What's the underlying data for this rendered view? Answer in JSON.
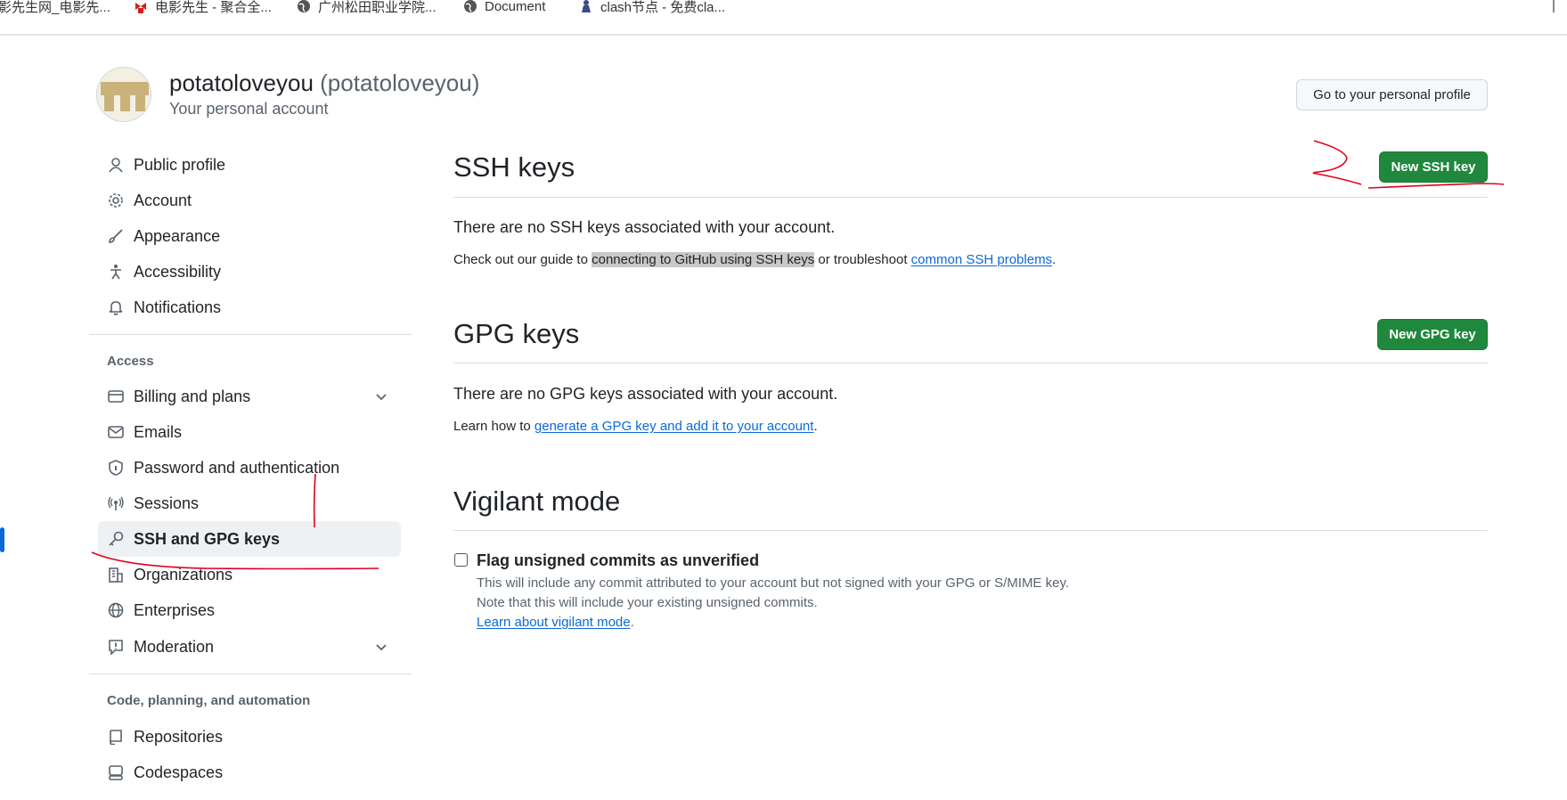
{
  "bookmarks": [
    {
      "label": "影先生网_电影先...",
      "icon": "page-icon"
    },
    {
      "label": "电影先生 - 聚合全...",
      "icon": "bow-icon",
      "color": "#d21f1f"
    },
    {
      "label": "广州松田职业学院...",
      "icon": "globe-icon"
    },
    {
      "label": "Document",
      "icon": "globe-icon"
    },
    {
      "label": "clash节点 - 免费cla...",
      "icon": "person-icon",
      "color": "#3b4a8c"
    }
  ],
  "header": {
    "display_name": "potatoloveyou",
    "login": "(potatoloveyou)",
    "subtitle": "Your personal account",
    "profile_button": "Go to your personal profile"
  },
  "sidebar": {
    "items": [
      {
        "label": "Public profile",
        "icon": "person-icon"
      },
      {
        "label": "Account",
        "icon": "gear-icon"
      },
      {
        "label": "Appearance",
        "icon": "paintbrush-icon"
      },
      {
        "label": "Accessibility",
        "icon": "accessibility-icon"
      },
      {
        "label": "Notifications",
        "icon": "bell-icon"
      }
    ],
    "access_title": "Access",
    "access_items": [
      {
        "label": "Billing and plans",
        "icon": "credit-card-icon",
        "expandable": true
      },
      {
        "label": "Emails",
        "icon": "mail-icon"
      },
      {
        "label": "Password and authentication",
        "icon": "shield-lock-icon"
      },
      {
        "label": "Sessions",
        "icon": "broadcast-icon"
      },
      {
        "label": "SSH and GPG keys",
        "icon": "key-icon",
        "active": true
      },
      {
        "label": "Organizations",
        "icon": "organization-icon"
      },
      {
        "label": "Enterprises",
        "icon": "globe-icon"
      },
      {
        "label": "Moderation",
        "icon": "report-icon",
        "expandable": true
      }
    ],
    "code_title": "Code, planning, and automation",
    "code_items": [
      {
        "label": "Repositories",
        "icon": "repo-icon"
      },
      {
        "label": "Codespaces",
        "icon": "codespaces-icon"
      }
    ]
  },
  "ssh": {
    "title": "SSH keys",
    "button": "New SSH key",
    "empty": "There are no SSH keys associated with your account.",
    "guide_prefix": "Check out our guide to",
    "guide_link": "connecting to GitHub using SSH keys",
    "guide_mid": "or troubleshoot",
    "guide_link2": "common SSH problems",
    "guide_suffix": "."
  },
  "gpg": {
    "title": "GPG keys",
    "button": "New GPG key",
    "empty": "There are no GPG keys associated with your account.",
    "learn_prefix": "Learn how to",
    "learn_link": "generate a GPG key and add it to your account",
    "learn_suffix": "."
  },
  "vigilant": {
    "title": "Vigilant mode",
    "checkbox_label": "Flag unsigned commits as unverified",
    "checked": false,
    "note1": "This will include any commit attributed to your account but not signed with your GPG or S/MIME key.",
    "note2": "Note that this will include your existing unsigned commits.",
    "learn_link": "Learn about vigilant mode",
    "learn_suffix": "."
  },
  "colors": {
    "accent": "#0969da",
    "primary_button": "#1f883d",
    "annotation": "#e0001b"
  }
}
